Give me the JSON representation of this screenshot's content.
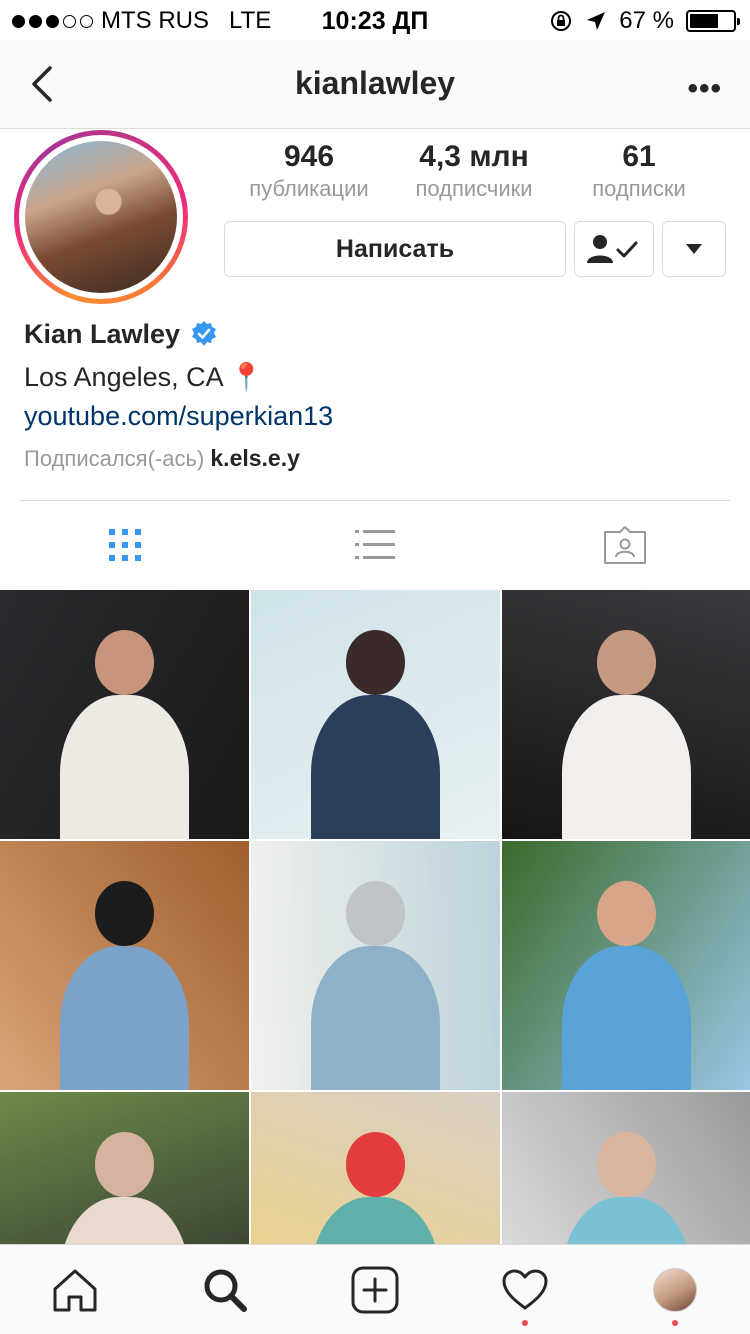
{
  "status_bar": {
    "carrier": "MTS RUS",
    "network": "LTE",
    "time": "10:23 ДП",
    "battery_percent": "67 %",
    "battery_level": 0.67,
    "signal_bars_filled": 3
  },
  "header": {
    "username": "kianlawley",
    "back_icon": "chevron-left-icon",
    "more_icon": "ellipsis-icon",
    "more_label": "•••"
  },
  "stats": {
    "posts_count": "946",
    "posts_label": "публикации",
    "followers_count": "4,3 млн",
    "followers_label": "подписчики",
    "following_count": "61",
    "following_label": "подписки"
  },
  "actions": {
    "message_label": "Написать",
    "following_icon": "person-check-icon",
    "dropdown_icon": "triangle-down-icon"
  },
  "bio": {
    "full_name": "Kian Lawley",
    "verified_icon": "verified-badge-icon",
    "location": "Los Angeles, CA 📍",
    "website": "youtube.com/superkian13",
    "followed_by_prefix": "Подписался(-ась)",
    "followed_by_user": "k.els.e.y"
  },
  "tabs": [
    {
      "name": "grid-view",
      "icon": "grid-icon",
      "active": true
    },
    {
      "name": "list-view",
      "icon": "list-icon",
      "active": false
    },
    {
      "name": "tagged",
      "icon": "tagged-person-icon",
      "active": false
    }
  ],
  "colors": {
    "accent_blue": "#3897f0",
    "link_blue": "#003569",
    "notification_red": "#ed4956",
    "text_primary": "#262626",
    "text_secondary": "#999999"
  },
  "posts": [
    {
      "palette": [
        "#2a2a2e",
        "#efe9e4",
        "#c8957c",
        "#1a1a1a"
      ]
    },
    {
      "palette": [
        "#cfe3e8",
        "#2b3e5c",
        "#3b2a2a",
        "#e8f0f2"
      ]
    },
    {
      "palette": [
        "#3a3a3e",
        "#f1eeec",
        "#c59a80",
        "#151515"
      ]
    },
    {
      "palette": [
        "#a15e2c",
        "#7ba2c8",
        "#1c1c1c",
        "#d8a57a"
      ]
    },
    {
      "palette": [
        "#bcd3db",
        "#8eb0c9",
        "#c0c4c6",
        "#f1f1ee"
      ]
    },
    {
      "palette": [
        "#3a6a2a",
        "#5aa3d8",
        "#d9a589",
        "#9bc6e6"
      ]
    },
    {
      "palette": [
        "#6c8a4a",
        "#e9d9cf",
        "#d6b3a0",
        "#2a2a2a"
      ]
    },
    {
      "palette": [
        "#d8cfc4",
        "#5eb0a8",
        "#e23c3c",
        "#f1d27a"
      ]
    },
    {
      "palette": [
        "#9a9a9a",
        "#7bc1d6",
        "#d9b59e",
        "#e6e6e6"
      ]
    }
  ],
  "bottom_nav": [
    {
      "name": "home",
      "icon": "home-icon",
      "badge": false
    },
    {
      "name": "search",
      "icon": "search-icon",
      "badge": false
    },
    {
      "name": "new-post",
      "icon": "plus-square-icon",
      "badge": false
    },
    {
      "name": "activity",
      "icon": "heart-icon",
      "badge": true
    },
    {
      "name": "profile",
      "icon": "profile-avatar-icon",
      "badge": true
    }
  ]
}
